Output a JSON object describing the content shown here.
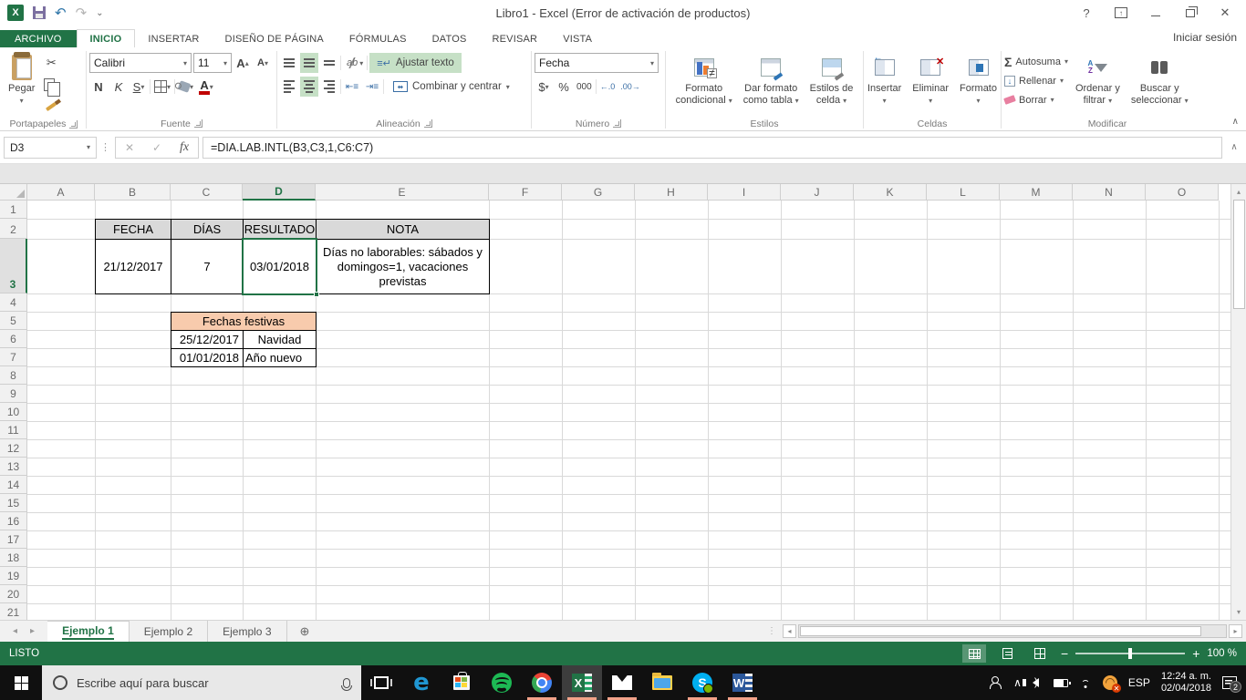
{
  "titlebar": {
    "title": "Libro1 - Excel (Error de activación de productos)",
    "sign_in": "Iniciar sesión"
  },
  "ribbon_tabs": {
    "file": "ARCHIVO",
    "home": "INICIO",
    "insert": "INSERTAR",
    "page_layout": "DISEÑO DE PÁGINA",
    "formulas": "FÓRMULAS",
    "data": "DATOS",
    "review": "REVISAR",
    "view": "VISTA"
  },
  "ribbon": {
    "clipboard": {
      "paste": "Pegar",
      "label": "Portapapeles"
    },
    "font": {
      "name": "Calibri",
      "size": "11",
      "bold": "N",
      "italic": "K",
      "underline": "S",
      "label": "Fuente"
    },
    "alignment": {
      "wrap_text": "Ajustar texto",
      "merge_center": "Combinar y centrar",
      "label": "Alineación"
    },
    "number": {
      "format": "Fecha",
      "currency": "$",
      "percent": "%",
      "thousands": "000",
      "label": "Número"
    },
    "styles": {
      "conditional_1": "Formato",
      "conditional_2": "condicional",
      "table_1": "Dar formato",
      "table_2": "como tabla",
      "cell_1": "Estilos de",
      "cell_2": "celda",
      "label": "Estilos"
    },
    "cells": {
      "insert": "Insertar",
      "delete": "Eliminar",
      "format": "Formato",
      "label": "Celdas"
    },
    "editing": {
      "autosum": "Autosuma",
      "fill": "Rellenar",
      "clear": "Borrar",
      "sort_1": "Ordenar y",
      "sort_2": "filtrar",
      "find_1": "Buscar y",
      "find_2": "seleccionar",
      "label": "Modificar"
    }
  },
  "formula_bar": {
    "name_box": "D3",
    "formula": "=DIA.LAB.INTL(B3,C3,1,C6:C7)"
  },
  "grid": {
    "columns": [
      "A",
      "B",
      "C",
      "D",
      "E",
      "F",
      "G",
      "H",
      "I",
      "J",
      "K",
      "L",
      "M",
      "N",
      "O"
    ],
    "row_count": 21,
    "selected_column": "D",
    "selected_row": 3,
    "cells": [
      {
        "ref": "B2",
        "text": "FECHA",
        "role": "bordered center fill-gray"
      },
      {
        "ref": "C2",
        "text": "DÍAS",
        "role": "bordered center fill-gray"
      },
      {
        "ref": "D2",
        "text": "RESULTADO",
        "role": "bordered center fill-gray"
      },
      {
        "ref": "E2",
        "text": "NOTA",
        "role": "bordered center fill-gray"
      },
      {
        "ref": "B3",
        "text": "21/12/2017",
        "role": "bordered center"
      },
      {
        "ref": "C3",
        "text": "7",
        "role": "bordered center"
      },
      {
        "ref": "D3",
        "text": "03/01/2018",
        "role": "bordered center selected"
      },
      {
        "ref": "E3",
        "text": "Días no laborables: sábados y domingos=1, vacaciones previstas",
        "role": "bordered center wrap"
      },
      {
        "ref": "C5:D5",
        "text": "Fechas festivas",
        "role": "bordered center fill-peach"
      },
      {
        "ref": "C6",
        "text": "25/12/2017",
        "role": "bordered right"
      },
      {
        "ref": "D6",
        "text": "Navidad",
        "role": "bordered center"
      },
      {
        "ref": "C7",
        "text": "01/01/2018",
        "role": "bordered right"
      },
      {
        "ref": "D7",
        "text": "Año nuevo",
        "role": "bordered left"
      }
    ]
  },
  "sheet_tabs": [
    "Ejemplo 1",
    "Ejemplo 2",
    "Ejemplo 3"
  ],
  "status_bar": {
    "mode": "LISTO",
    "zoom": "100 %"
  },
  "taskbar": {
    "search_placeholder": "Escribe aquí para buscar",
    "language": "ESP",
    "time": "12:24 a. m.",
    "date": "02/04/2018",
    "notification_count": "2"
  },
  "icons": {
    "undo": "↶",
    "redo": "↷",
    "qat_dropdown": "⌄",
    "help": "?",
    "close": "✕",
    "cut": "✂",
    "check": "✓",
    "fx": "fx",
    "caret_down": "▾",
    "caret_up": "▴",
    "sigma": "Σ",
    "up_small": "▴",
    "down_small": "▾",
    "left_small": "◂",
    "right_small": "▸",
    "add_sheet": "⊕",
    "dots": "⋮",
    "collapse": "∧",
    "chevron_up": "∧",
    "minus": "−",
    "plus": "+",
    "font_grow": "A",
    "font_shrink": "A",
    "dec_left": "←.0",
    "dec_right": ".00→",
    "skype_s": "S",
    "excel_x": "X",
    "word_w": "W",
    "edge_e": "e"
  },
  "colors": {
    "excel_green": "#217346",
    "selection_green": "#217346",
    "table_header_fill": "#d9d9d9",
    "festivas_fill": "#f8cbad",
    "ribbon_toggle_green": "#c6e0c6",
    "taskbar_indicator": "#f2a289"
  }
}
